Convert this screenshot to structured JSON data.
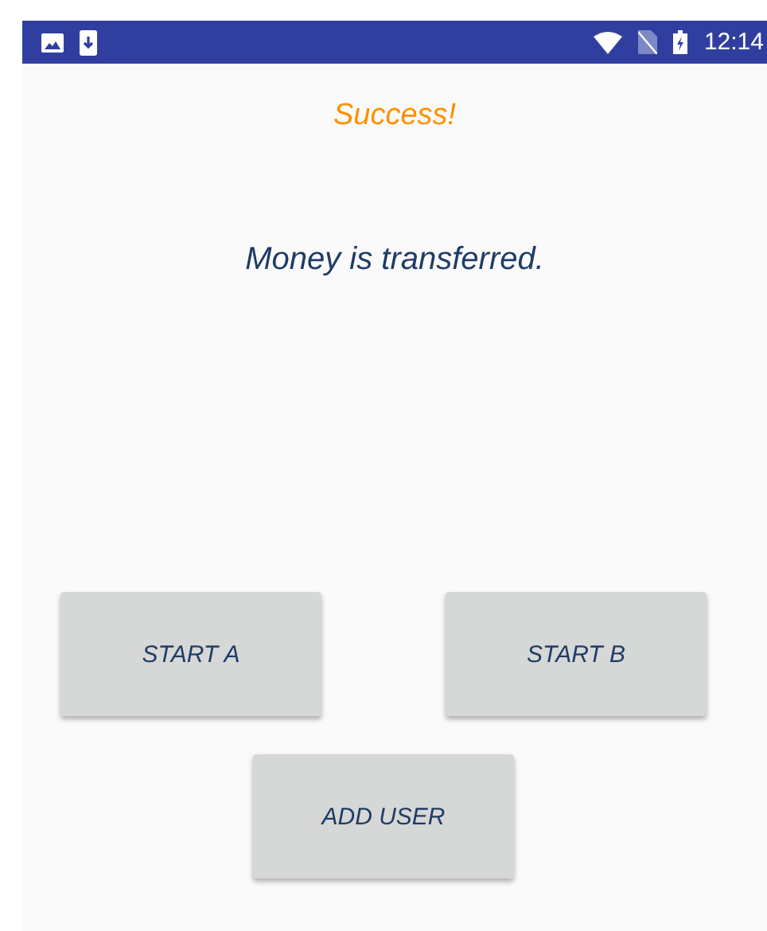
{
  "status_bar": {
    "time": "12:14"
  },
  "title": "Success!",
  "message": "Money is transferred.",
  "buttons": [
    {
      "label": "START A"
    },
    {
      "label": "START B"
    },
    {
      "label": "ADD USER"
    }
  ]
}
